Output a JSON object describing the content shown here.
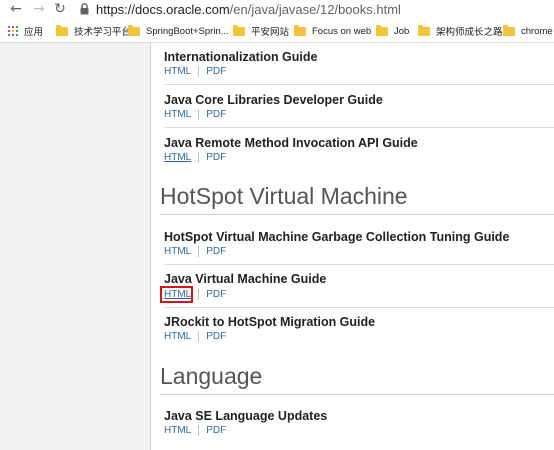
{
  "browser": {
    "url_host": "https://docs.oracle.com",
    "url_path": "/en/java/javase/12/books.html",
    "bookmarks": [
      "应用",
      "技术学习平台",
      "SpringBoot+Sprin...",
      "平安网站",
      "Focus on web",
      "Job",
      "架构师成长之路",
      "chrome"
    ]
  },
  "content": {
    "links": {
      "html": "HTML",
      "pdf": "PDF"
    },
    "group1": [
      "Internationalization Guide",
      "Java Core Libraries Developer Guide",
      "Java Remote Method Invocation API Guide"
    ],
    "section_hotspot": "HotSpot Virtual Machine",
    "group2": [
      "HotSpot Virtual Machine Garbage Collection Tuning Guide",
      "Java Virtual Machine Guide",
      "JRockit to HotSpot Migration Guide"
    ],
    "section_language": "Language",
    "group3": [
      "Java SE Language Updates"
    ],
    "colors": {
      "link": "#2c6aa0",
      "highlight": "#dd1111"
    }
  }
}
